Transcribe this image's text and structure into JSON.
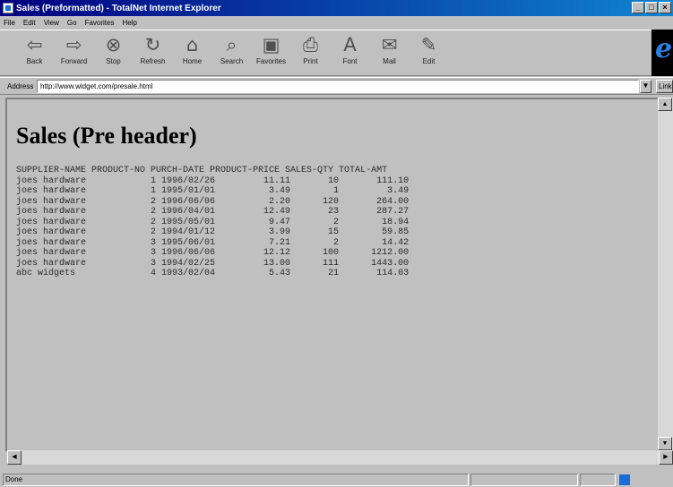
{
  "window": {
    "title": "Sales (Preformatted) - TotalNet Internet Explorer"
  },
  "menubar": [
    "File",
    "Edit",
    "View",
    "Go",
    "Favorites",
    "Help"
  ],
  "toolbar": [
    {
      "label": "Back",
      "icon": "back-arrow-icon",
      "glyph": "⇦"
    },
    {
      "label": "Forward",
      "icon": "forward-arrow-icon",
      "glyph": "⇨"
    },
    {
      "label": "Stop",
      "icon": "stop-icon",
      "glyph": "⊗"
    },
    {
      "label": "Refresh",
      "icon": "refresh-icon",
      "glyph": "↻"
    },
    {
      "label": "Home",
      "icon": "home-icon",
      "glyph": "⌂"
    },
    {
      "label": "Search",
      "icon": "search-icon",
      "glyph": "⌕"
    },
    {
      "label": "Favorites",
      "icon": "favorites-icon",
      "glyph": "▣"
    },
    {
      "label": "Print",
      "icon": "print-icon",
      "glyph": "⎙"
    },
    {
      "label": "Font",
      "icon": "font-icon",
      "glyph": "A"
    },
    {
      "label": "Mail",
      "icon": "mail-icon",
      "glyph": "✉"
    },
    {
      "label": "Edit",
      "icon": "edit-icon",
      "glyph": "✎"
    }
  ],
  "address": {
    "label": "Address",
    "url": "http://www.widget.com/presale.html",
    "links_label": "Link"
  },
  "page": {
    "heading": "Sales (Pre header)",
    "report": "SUPPLIER-NAME PRODUCT-NO PURCH-DATE PRODUCT-PRICE SALES-QTY TOTAL-AMT\njoes hardware            1 1996/02/26         11.11       10       111.10\njoes hardware            1 1995/01/01          3.49        1         3.49\njoes hardware            2 1996/06/06          2.20      120       264.00\njoes hardware            2 1996/04/01         12.49       23       287.27\njoes hardware            2 1995/05/01          9.47        2        18.94\njoes hardware            2 1994/01/12          3.99       15        59.85\njoes hardware            3 1995/06/01          7.21        2        14.42\njoes hardware            3 1996/06/06         12.12      100      1212.00\njoes hardware            3 1994/02/25         13.00      111      1443.00\nabc widgets              4 1993/02/04          5.43       21       114.03"
  },
  "status": {
    "text": "Done"
  },
  "colors": {
    "titlebar_start": "#000080",
    "titlebar_end": "#1084d0",
    "chrome": "#c0c0c0"
  }
}
